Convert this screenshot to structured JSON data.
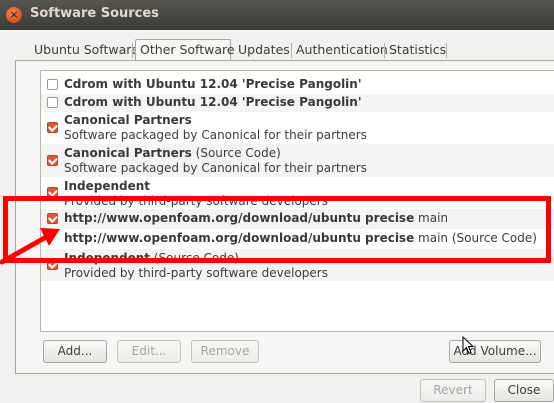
{
  "window": {
    "title": "Software Sources",
    "close_glyph": "×"
  },
  "tabs": [
    {
      "label": "Ubuntu Software",
      "active": false
    },
    {
      "label": "Other Software",
      "active": true
    },
    {
      "label": "Updates",
      "active": false
    },
    {
      "label": "Authentication",
      "active": false
    },
    {
      "label": "Statistics",
      "active": false
    }
  ],
  "sources": [
    {
      "checked": false,
      "name": "Cdrom with Ubuntu 12.04 'Precise Pangolin'",
      "suffix": "",
      "description": ""
    },
    {
      "checked": false,
      "name": "Cdrom with Ubuntu 12.04 'Precise Pangolin'",
      "suffix": "",
      "description": ""
    },
    {
      "checked": true,
      "name": "Canonical Partners",
      "suffix": "",
      "description": "Software packaged by Canonical for their partners"
    },
    {
      "checked": true,
      "name": "Canonical Partners",
      "suffix": " (Source Code)",
      "description": "Software packaged by Canonical for their partners"
    },
    {
      "checked": true,
      "name": "Independent",
      "suffix": "",
      "description": "Provided by third-party software developers"
    },
    {
      "checked": true,
      "name": "http://www.openfoam.org/download/ubuntu precise",
      "suffix": " main",
      "description": ""
    },
    {
      "checked": false,
      "name": "http://www.openfoam.org/download/ubuntu precise",
      "suffix": " main (Source Code)",
      "description": ""
    },
    {
      "checked": true,
      "name": "Independent",
      "suffix": " (Source Code)",
      "description": "Provided by third-party software developers"
    }
  ],
  "buttons": {
    "add": "Add...",
    "edit": "Edit...",
    "remove": "Remove",
    "add_volume": "Add Volume...",
    "revert": "Revert",
    "close": "Close"
  },
  "annotation": {
    "color": "#ff0000"
  },
  "colors": {
    "accent": "#dd5a35",
    "titlebar": "#3c3b37"
  }
}
